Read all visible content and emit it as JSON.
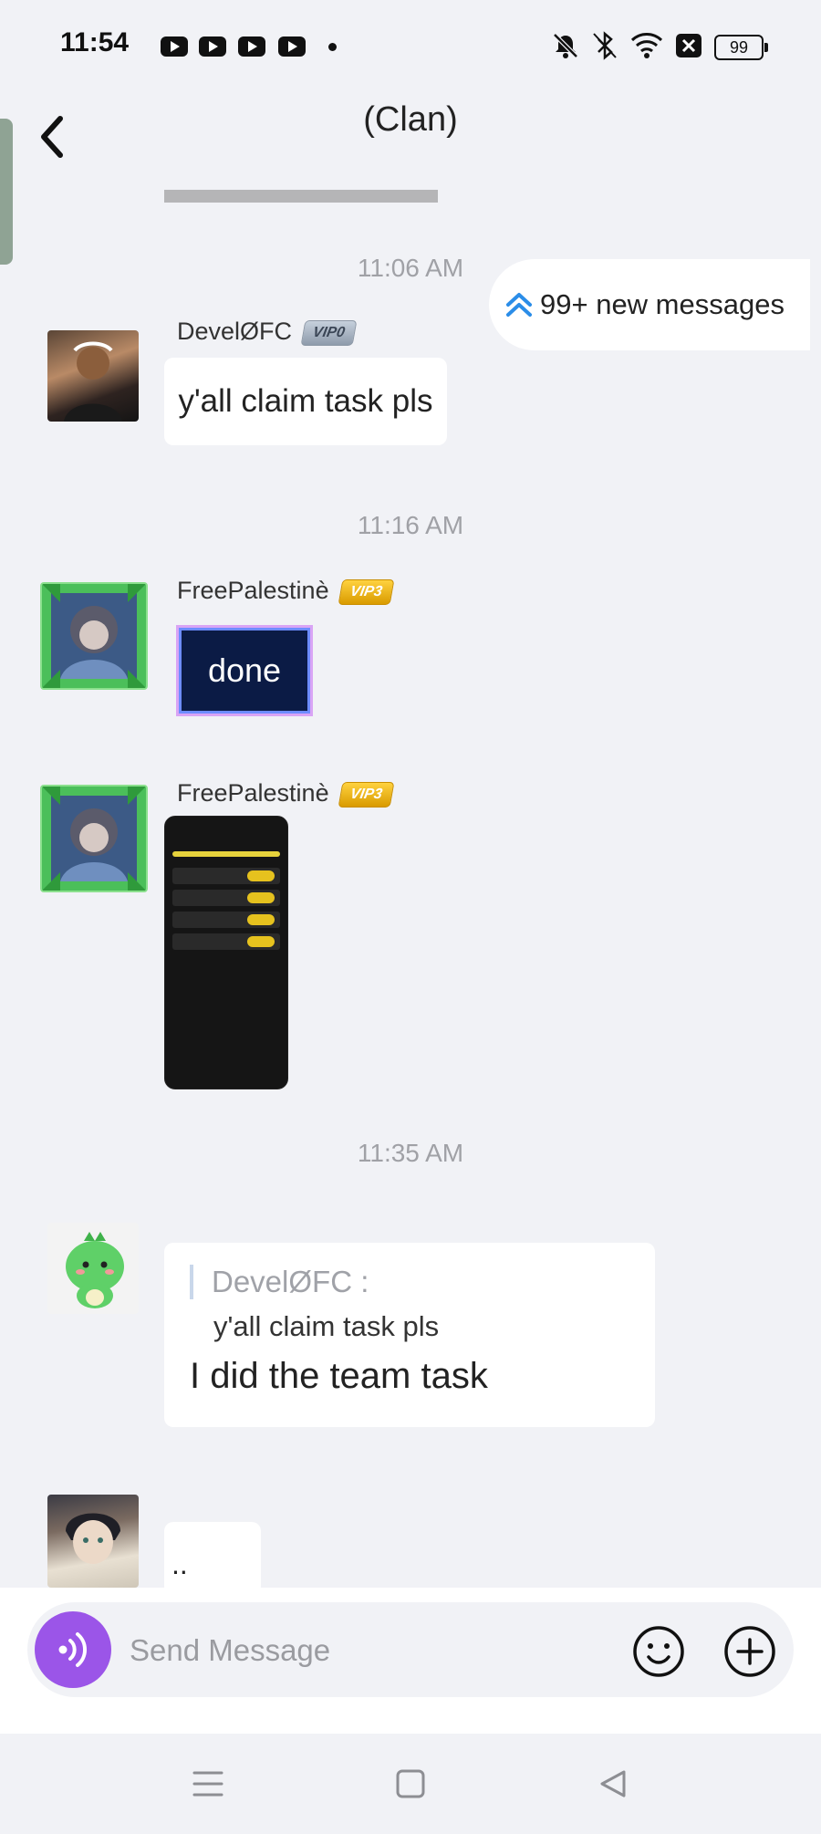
{
  "status_bar": {
    "time": "11:54",
    "battery": "99",
    "icons": [
      "youtube-icon",
      "youtube-icon",
      "youtube-icon",
      "youtube-icon",
      "notification-dot",
      "mute-icon",
      "bluetooth-icon",
      "wifi-icon",
      "sim-icon",
      "battery-icon"
    ]
  },
  "header": {
    "title": "(Clan)"
  },
  "new_messages": {
    "label": "99+ new messages"
  },
  "messages": [
    {
      "timestamp": "11:06 AM",
      "user": "DevelØFC",
      "vip": "VIP0",
      "text": "y'all claim task pls"
    },
    {
      "timestamp": "11:16 AM",
      "user": "FreePalestinè",
      "vip": "VIP3",
      "text": "done"
    },
    {
      "user": "FreePalestinè",
      "vip": "VIP3",
      "image": "screenshot"
    },
    {
      "timestamp": "11:35 AM",
      "reply_to_user": "DevelØFC  :",
      "reply_to_text": "y'all claim task pls",
      "text": "I did the team task"
    },
    {
      "text": ".."
    }
  ],
  "composer": {
    "placeholder": "Send Message"
  },
  "colors": {
    "background": "#f1f2f6",
    "voice_button": "#9b55e8",
    "arrow_accent": "#2b8de8",
    "vip_gold": "#e0a800"
  }
}
